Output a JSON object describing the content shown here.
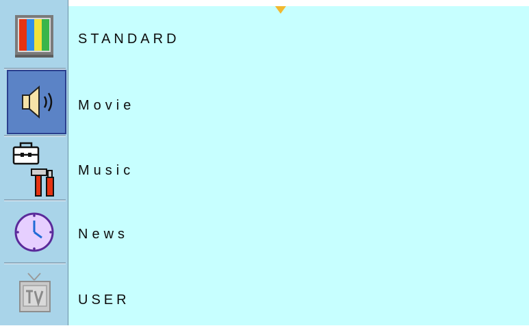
{
  "menu": {
    "title": "",
    "rail": [
      {
        "id": "picture",
        "icon": "color-bars-icon",
        "selected": false
      },
      {
        "id": "sound",
        "icon": "speaker-icon",
        "selected": true
      },
      {
        "id": "setup",
        "icon": "toolbox-icon",
        "selected": false
      },
      {
        "id": "time",
        "icon": "clock-icon",
        "selected": false
      },
      {
        "id": "tv",
        "icon": "tv-icon",
        "selected": false
      }
    ],
    "options": [
      {
        "label": "STANDARD"
      },
      {
        "label": "Movie"
      },
      {
        "label": "Music"
      },
      {
        "label": "News"
      },
      {
        "label": "USER"
      }
    ],
    "colors": {
      "rail_bg": "#a9d4e9",
      "selected_bg": "#5b83c6",
      "panel_bg": "#c7ffff",
      "pointer": "#f2b830"
    }
  }
}
